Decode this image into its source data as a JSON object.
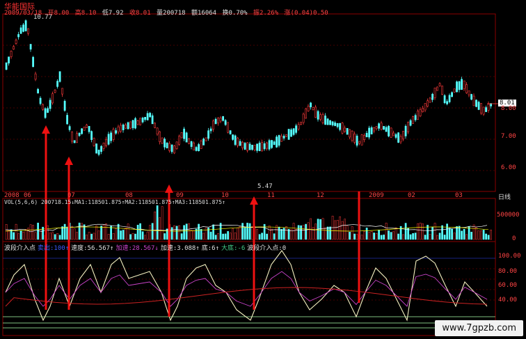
{
  "stock": {
    "name": "华能国际",
    "date": "2009/03/18",
    "open_label": "开8.00",
    "high_label": "高8.10",
    "low_label": "低7.92",
    "close_label": "收8.01",
    "volume_label": "量200718",
    "amount_label": "额16064",
    "turnover_label": "换0.70%",
    "amplitude_label": "振2.26%",
    "change_label": "涨(0.04)0.50"
  },
  "price_panel": {
    "high_marker": "10.77",
    "low_marker": "5.47",
    "current_price": "8.01",
    "y_ticks": [
      "8.00",
      "7.00",
      "6.00"
    ],
    "date_axis": [
      "2008",
      "06",
      "07",
      "08",
      "09",
      "10",
      "11",
      "12",
      "2009",
      "02",
      "03"
    ],
    "period_label": "日线"
  },
  "volume_panel": {
    "header": "VOL(5,6,6) 200718.15↓MA1:118501.875↑MA2:118501.875↑MA3:118501.875↑",
    "y_ticks": [
      "500000",
      "0"
    ]
  },
  "indicator_panel": {
    "name": "波段介入点",
    "header_parts": [
      {
        "text": "波段介入点",
        "color": "#e0e0e0"
      },
      {
        "text": "卖出:100↑",
        "color": "#3b5bff"
      },
      {
        "text": "速度:56.567↑",
        "color": "#e0e0e0"
      },
      {
        "text": "加速:28.567↓",
        "color": "#cc44cc"
      },
      {
        "text": "加速:3.088↑",
        "color": "#e0e0e0"
      },
      {
        "text": "底:6↑",
        "color": "#e0e0e0"
      },
      {
        "text": "大底:-6",
        "color": "#44cc88"
      },
      {
        "text": "波段介入点:0",
        "color": "#e0e0e0"
      }
    ],
    "y_ticks": [
      "100.00",
      "80.00",
      "60.00",
      "40.00"
    ]
  },
  "colors": {
    "up": "#ff3b3b",
    "down": "#55ffff",
    "grid": "#8b0000",
    "arrow": "#ee1111",
    "ma_white": "#ffffff",
    "ma_yellow": "#ffff00",
    "ma_purple": "#cc44cc",
    "ma_green": "#22aa55"
  },
  "watermark": "www.7gpzb.com"
}
